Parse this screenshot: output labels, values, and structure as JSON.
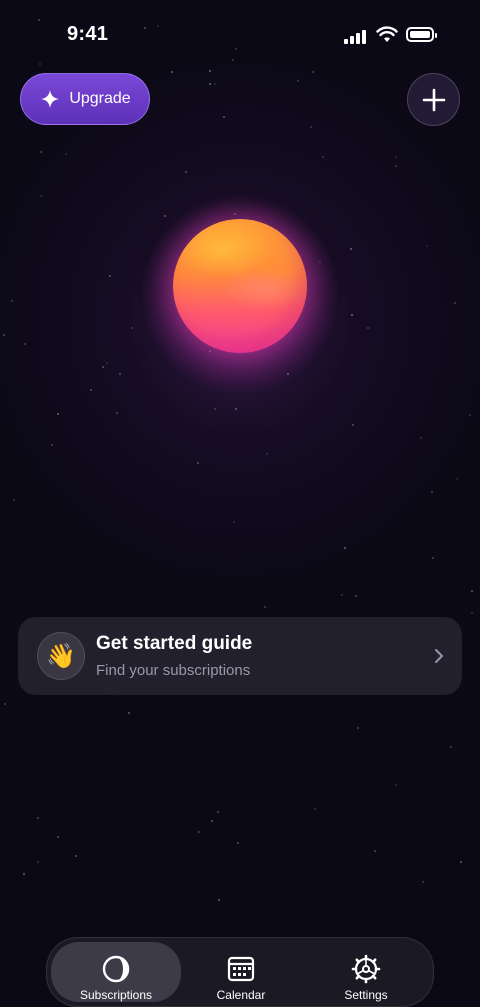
{
  "status_bar": {
    "time": "9:41"
  },
  "header": {
    "upgrade_label": "Upgrade",
    "upgrade_icon": "sparkle-icon",
    "add_icon": "plus-icon"
  },
  "guide": {
    "emoji": "👋",
    "title": "Get started guide",
    "subtitle": "Find your subscriptions",
    "chevron_icon": "chevron-right-icon"
  },
  "tabs": [
    {
      "label": "Subscriptions",
      "icon": "moon-phase-icon",
      "active": true
    },
    {
      "label": "Calendar",
      "icon": "calendar-icon",
      "active": false
    },
    {
      "label": "Settings",
      "icon": "gear-icon",
      "active": false
    }
  ],
  "colors": {
    "background": "#0c0917",
    "accent": "#6a3bc8",
    "planet_top": "#ffa334",
    "planet_bottom": "#f23d93"
  }
}
